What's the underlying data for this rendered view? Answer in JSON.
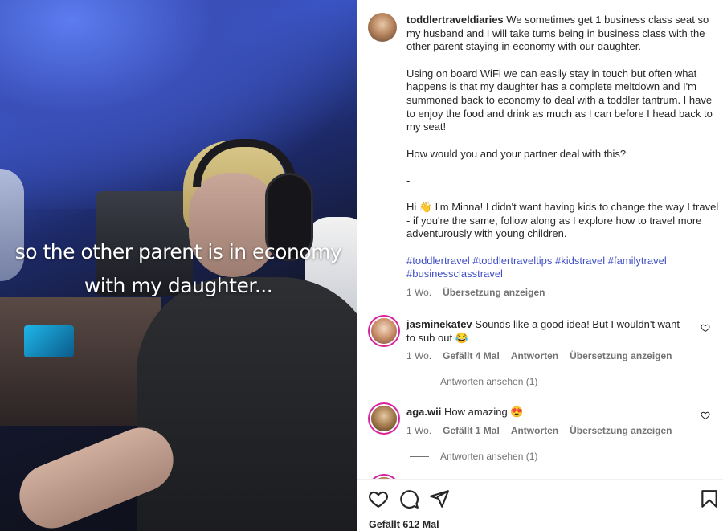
{
  "media": {
    "caption_line1": "so the other parent is in economy",
    "caption_line2": "with my daughter..."
  },
  "post": {
    "username": "toddlertraveldiaries",
    "caption_p1": "We sometimes get 1 business class seat so my husband and I will take turns being in business class with the other parent staying in economy with our daughter.",
    "caption_p2": "Using on board WiFi we can easily stay in touch but often what happens is that my daughter has a complete meltdown and I'm summoned back to economy to deal with a toddler tantrum. I have to enjoy the food and drink as much as I can before I head back to my seat!",
    "caption_p3": "How would you and your partner deal with this?",
    "caption_p4": "-",
    "caption_p5": "Hi 👋 I'm Minna! I didn't want having kids to change the way I travel - if you're the same, follow along as I explore how to travel more adventurously with young children.",
    "hashtags": "#toddlertravel #toddlertraveltips #kidstravel #familytravel #businessclasstravel",
    "time": "1 Wo.",
    "translate": "Übersetzung anzeigen"
  },
  "comments": [
    {
      "username": "jasminekatev",
      "text": "Sounds like a good idea! But I wouldn't want to sub out",
      "emoji": "😂",
      "time": "1 Wo.",
      "likes": "Gefällt 4 Mal",
      "reply": "Antworten",
      "translate": "Übersetzung anzeigen",
      "view_replies": "Antworten ansehen (1)"
    },
    {
      "username": "aga.wii",
      "text": "How amazing",
      "emoji": "😍",
      "time": "1 Wo.",
      "likes": "Gefällt 1 Mal",
      "reply": "Antworten",
      "translate": "Übersetzung anzeigen",
      "view_replies": "Antworten ansehen (1)"
    }
  ],
  "footer": {
    "likes": "Gefällt 612 Mal"
  },
  "colors": {
    "hashtag": "#4150c7",
    "muted": "#737373",
    "story_ring": "#d6249f"
  },
  "icons": [
    "heart-icon",
    "comment-icon",
    "share-icon",
    "bookmark-icon"
  ]
}
